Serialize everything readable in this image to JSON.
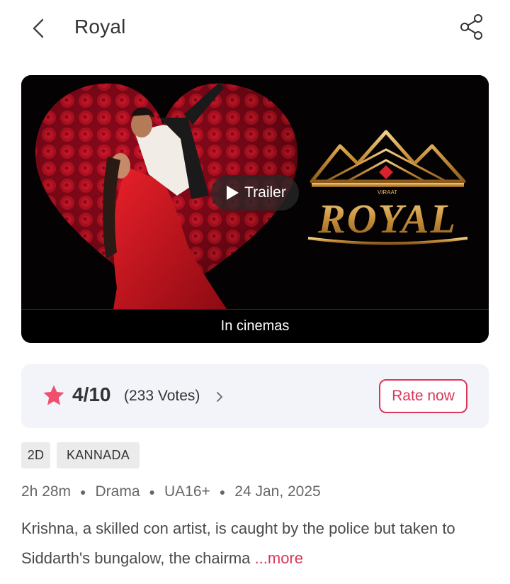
{
  "header": {
    "title": "Royal",
    "back_icon": "chevron-left-icon",
    "share_icon": "share-icon"
  },
  "hero": {
    "poster_title": "ROYAL",
    "poster_small_text": "VIRAAT",
    "trailer_label": "Trailer",
    "status_label": "In cinemas"
  },
  "rating": {
    "score": "4/10",
    "votes": "(233 Votes)",
    "rate_label": "Rate now",
    "star_color": "#f0506e"
  },
  "tags": [
    "2D",
    "KANNADA"
  ],
  "meta": {
    "duration": "2h 28m",
    "genre": "Drama",
    "certificate": "UA16+",
    "release_date": "24 Jan, 2025"
  },
  "synopsis": {
    "text": "Krishna, a skilled con artist, is caught by the police but taken to Siddarth's bungalow, the chairma",
    "more_label": "...more"
  },
  "colors": {
    "accent": "#dc3558",
    "card_bg": "#f2f4f9",
    "tag_bg": "#ebebeb"
  }
}
